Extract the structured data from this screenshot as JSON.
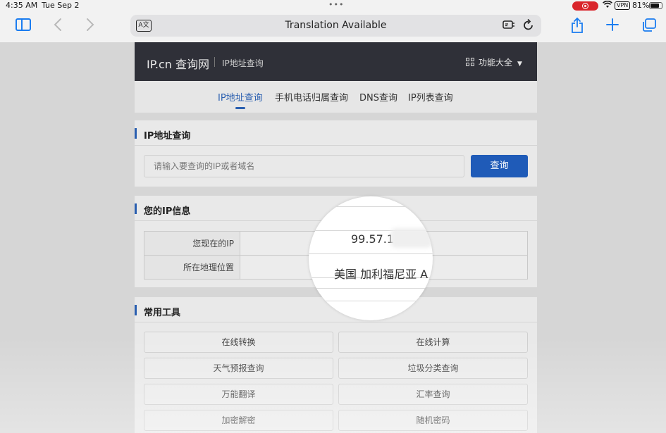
{
  "status_bar": {
    "time": "4:35 AM",
    "date": "Tue Sep 2",
    "vpn": "VPN",
    "battery_pct": "81%",
    "battery_level": 0.81
  },
  "browser": {
    "address_title": "Translation Available",
    "accent": "#1a7cf0"
  },
  "site": {
    "logo": "IP.cn 查询网",
    "subtitle": "IP地址查询",
    "menu_label": "功能大全",
    "nav_tabs": [
      {
        "label": "IP地址查询",
        "active": true
      },
      {
        "label": "手机电话归属查询",
        "active": false
      },
      {
        "label": "DNS查询",
        "active": false
      },
      {
        "label": "IP列表查询",
        "active": false
      }
    ],
    "accent": "#2a5fb0",
    "search_card": {
      "title": "IP地址查询",
      "placeholder": "请输入要查询的IP或者域名",
      "button": "查询"
    },
    "ip_card": {
      "title": "您的IP信息",
      "rows": [
        {
          "key": "您现在的IP",
          "value": "99.57.1"
        },
        {
          "key": "所在地理位置",
          "value": "美国 加利福尼亚 A"
        }
      ]
    },
    "tools_card": {
      "title": "常用工具",
      "items": [
        "在线转换",
        "在线计算",
        "天气预报查询",
        "垃圾分类查询",
        "万能翻译",
        "汇率查询",
        "加密解密",
        "随机密码"
      ]
    }
  }
}
